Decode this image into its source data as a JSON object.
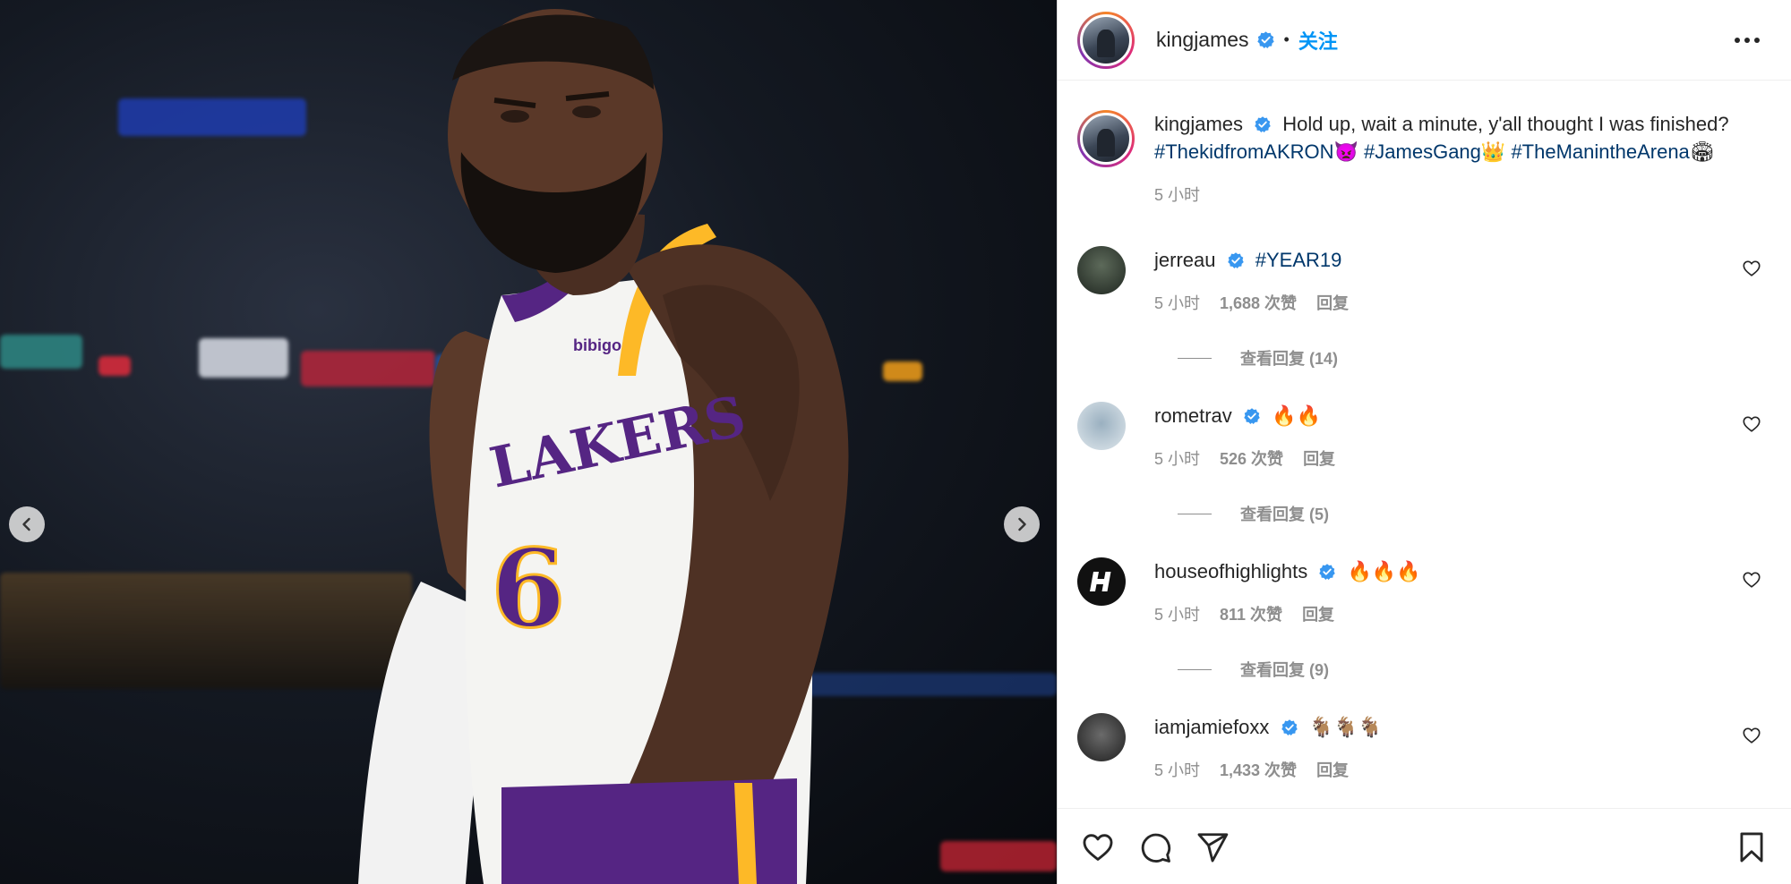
{
  "post": {
    "author": "kingjames",
    "separator": "•",
    "follow_label": "关注",
    "more_icon": "more-horizontal-icon",
    "caption": {
      "text": "Hold up, wait a minute, y'all thought I was finished?",
      "hashtags": [
        {
          "tag": "#ThekidfromAKRON",
          "emoji": "👿"
        },
        {
          "tag": "#JamesGang",
          "emoji": "👑"
        },
        {
          "tag": "#TheManintheArena",
          "emoji": "🏟"
        }
      ],
      "time": "5 小时"
    }
  },
  "comments": [
    {
      "user": "jerreau",
      "verified": true,
      "text": "#YEAR19",
      "is_hashtag": true,
      "time": "5 小时",
      "likes": "1,688 次赞",
      "reply_label": "回复",
      "view_replies": "查看回复 (14)"
    },
    {
      "user": "rometrav",
      "verified": true,
      "text": "🔥🔥",
      "is_hashtag": false,
      "time": "5 小时",
      "likes": "526 次赞",
      "reply_label": "回复",
      "view_replies": "查看回复 (5)"
    },
    {
      "user": "houseofhighlights",
      "verified": true,
      "text": "🔥🔥🔥",
      "is_hashtag": false,
      "time": "5 小时",
      "likes": "811 次赞",
      "reply_label": "回复",
      "view_replies": "查看回复 (9)"
    },
    {
      "user": "iamjamiefoxx",
      "verified": true,
      "text": "🐐🐐🐐",
      "is_hashtag": false,
      "time": "5 小时",
      "likes": "1,433 次赞",
      "reply_label": "回复",
      "view_replies": ""
    }
  ],
  "photo": {
    "jersey_team": "LAKERS",
    "jersey_number": "6",
    "patch": "bibigo"
  },
  "icons": {
    "prev": "chevron-left-icon",
    "next": "chevron-right-icon",
    "like": "heart-icon",
    "comment": "comment-icon",
    "share": "send-icon",
    "save": "bookmark-icon"
  },
  "colors": {
    "link": "#0095f6",
    "hashtag": "#00376b",
    "verified": "#3897f0",
    "muted": "#8e8e8e",
    "jersey_purple": "#552583",
    "jersey_gold": "#fdb927"
  }
}
